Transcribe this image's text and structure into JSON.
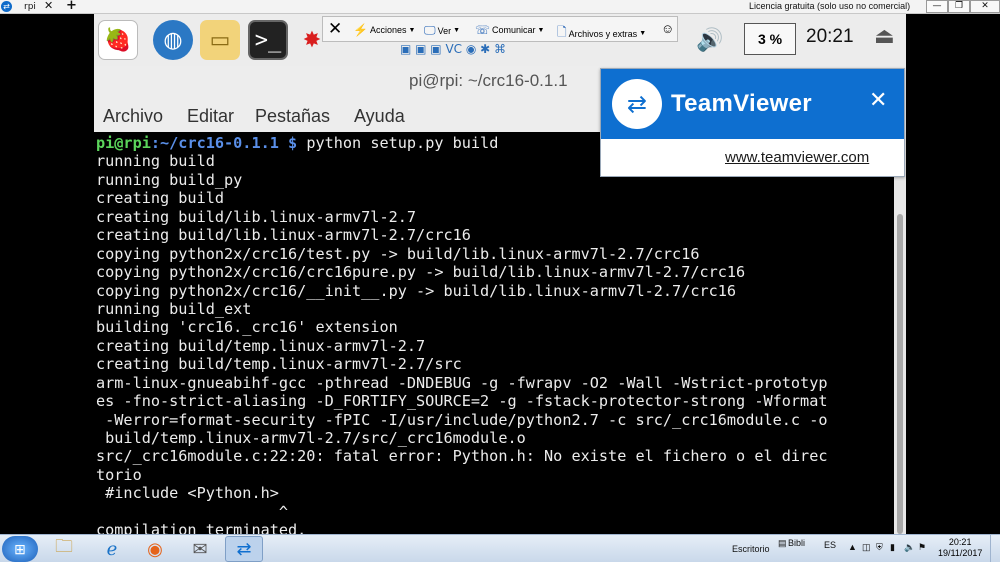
{
  "tv_tabbar": {
    "tab_label": "rpi",
    "close": "✕",
    "add": "+",
    "license": "Licencia gratuita (solo uso no comercial)",
    "min": "—",
    "max": "❐",
    "close_window": "✕"
  },
  "pi_panel": {
    "cpu": "3 %",
    "clock": "20:21"
  },
  "tv_toolbar": {
    "close": "✕",
    "actions": "Acciones",
    "view": "Ver",
    "communicate": "Comunicar",
    "files": "Archivos y extras"
  },
  "terminal": {
    "title": "pi@rpi: ~/crc16-0.1.1",
    "menu": [
      "Archivo",
      "Editar",
      "Pestañas",
      "Ayuda"
    ],
    "prompt_user": "pi@rpi",
    "prompt_path": ":~/crc16-0.1.1 $",
    "command": " python setup.py build",
    "lines": [
      "running build",
      "running build_py",
      "creating build",
      "creating build/lib.linux-armv7l-2.7",
      "creating build/lib.linux-armv7l-2.7/crc16",
      "copying python2x/crc16/test.py -> build/lib.linux-armv7l-2.7/crc16",
      "copying python2x/crc16/crc16pure.py -> build/lib.linux-armv7l-2.7/crc16",
      "copying python2x/crc16/__init__.py -> build/lib.linux-armv7l-2.7/crc16",
      "running build_ext",
      "building 'crc16._crc16' extension",
      "creating build/temp.linux-armv7l-2.7",
      "creating build/temp.linux-armv7l-2.7/src",
      "arm-linux-gnueabihf-gcc -pthread -DNDEBUG -g -fwrapv -O2 -Wall -Wstrict-prototyp",
      "es -fno-strict-aliasing -D_FORTIFY_SOURCE=2 -g -fstack-protector-strong -Wformat",
      " -Werror=format-security -fPIC -I/usr/include/python2.7 -c src/_crc16module.c -o",
      " build/temp.linux-armv7l-2.7/src/_crc16module.o",
      "src/_crc16module.c:22:20: fatal error: Python.h: No existe el fichero o el direc",
      "torio",
      " #include <Python.h>",
      "                    ^",
      "compilation terminated."
    ]
  },
  "teamviewer_popup": {
    "brand": "TeamViewer",
    "close": "✕",
    "link": "www.teamviewer.com"
  },
  "taskbar": {
    "desktop_label": "Escritorio",
    "bibli_label": "Bibli",
    "lang": "ES",
    "time": "20:21",
    "date": "19/11/2017"
  }
}
